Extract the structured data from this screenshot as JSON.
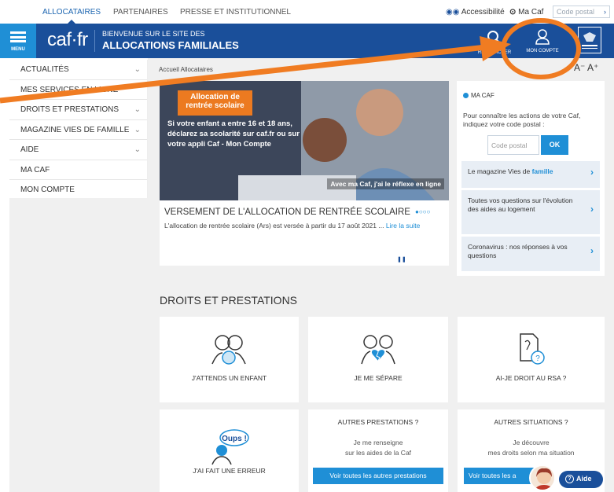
{
  "topnav": {
    "allocataires": "ALLOCATAIRES",
    "partenaires": "PARTENAIRES",
    "presse": "PRESSE ET INSTITUTIONNEL",
    "accessibilite": "Accessibilité",
    "ma_caf": "Ma Caf",
    "code_postal_placeholder": "Code postal"
  },
  "header": {
    "menu_label": "MENU",
    "logo": "caf·fr",
    "tagline_1": "BIENVENUE SUR LE SITE DES",
    "tagline_2": "ALLOCATIONS FAMILIALES",
    "search_label": "RECHERCHER",
    "account_label": "MON COMPTE"
  },
  "sidebar": {
    "items": [
      {
        "label": "ACTUALITÉS",
        "chevron": true
      },
      {
        "label": "MES SERVICES EN LIGNE",
        "chevron": false
      },
      {
        "label": "DROITS ET PRESTATIONS",
        "chevron": true
      },
      {
        "label": "MAGAZINE VIES DE FAMILLE",
        "chevron": true
      },
      {
        "label": "AIDE",
        "chevron": true
      },
      {
        "label": "MA CAF",
        "chevron": false
      },
      {
        "label": "MON COMPTE",
        "chevron": false
      }
    ]
  },
  "breadcrumb": "Accueil Allocataires",
  "font_controls": "A⁻ A⁺",
  "hero": {
    "tag": "Allocation de rentrée scolaire",
    "text": "Si votre enfant a entre 16 et 18 ans, déclarez sa scolarité sur caf.fr ou sur votre appli Caf - Mon Compte",
    "bottom": "Avec ma Caf, j'ai le réflexe en ligne"
  },
  "news": {
    "title": "VERSEMENT DE L'ALLOCATION DE RENTRÉE SCOLAIRE",
    "dots": "●○○○",
    "desc": "L'allocation de rentrée scolaire (Ars) est versée à partir du 17 août 2021 ...",
    "link": "Lire la suite",
    "pause": "❚❚"
  },
  "macaf": {
    "title": "MA CAF",
    "text": "Pour connaître les actions de votre Caf, indiquez votre code postal :",
    "input_placeholder": "Code postal",
    "ok": "OK"
  },
  "rlinks": [
    {
      "before": "Le magazine Vies de ",
      "highlight": "famille"
    },
    {
      "before": "Toutes vos questions sur l'évolution des aides au logement",
      "highlight": ""
    },
    {
      "before": "Coronavirus : nos réponses à vos questions",
      "highlight": ""
    }
  ],
  "section_title": "DROITS ET PRESTATIONS",
  "cards": {
    "enfant": "J'ATTENDS UN ENFANT",
    "separe": "JE ME SÉPARE",
    "rsa": "AI-JE DROIT AU RSA ?",
    "erreur": "J'AI FAIT UNE ERREUR",
    "oups": "Oups !",
    "autres_prestations_title": "AUTRES PRESTATIONS ?",
    "autres_prestations_sub_1": "Je me renseigne",
    "autres_prestations_sub_2": "sur les aides de la Caf",
    "autres_prestations_btn": "Voir toutes les autres prestations",
    "autres_situations_title": "AUTRES SITUATIONS ?",
    "autres_situations_sub_1": "Je découvre",
    "autres_situations_sub_2": "mes droits selon ma situation",
    "autres_situations_btn": "Voir toutes les a"
  },
  "aide": "Aide",
  "colors": {
    "header_blue": "#1a4f9a",
    "accent_blue": "#1f8fd6",
    "annotation_orange": "#f07c22"
  }
}
